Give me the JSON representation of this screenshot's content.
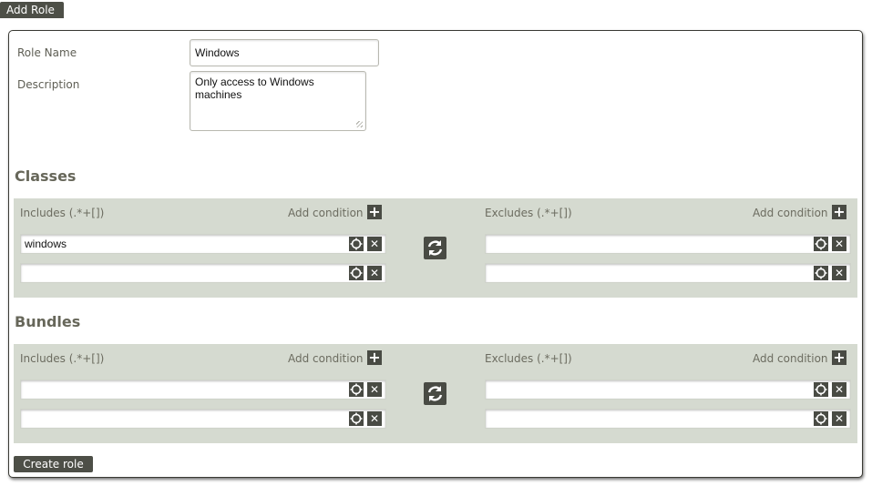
{
  "header": {
    "title": "Add Role"
  },
  "form": {
    "role_name_label": "Role Name",
    "role_name_value": "Windows",
    "description_label": "Description",
    "description_value": "Only access to Windows\nmachines"
  },
  "classes": {
    "title": "Classes",
    "includes": {
      "label": "Includes (.*+[])",
      "add_label": "Add condition",
      "rows": [
        "windows",
        ""
      ]
    },
    "excludes": {
      "label": "Excludes (.*+[])",
      "add_label": "Add condition",
      "rows": [
        "",
        ""
      ]
    }
  },
  "bundles": {
    "title": "Bundles",
    "includes": {
      "label": "Includes (.*+[])",
      "add_label": "Add condition",
      "rows": [
        "",
        ""
      ]
    },
    "excludes": {
      "label": "Excludes (.*+[])",
      "add_label": "Add condition",
      "rows": [
        "",
        ""
      ]
    }
  },
  "footer": {
    "create_label": "Create role"
  },
  "colors": {
    "accent": "#4d4f47",
    "band": "#d5dad0",
    "section_title": "#67675a"
  },
  "icons": {
    "add": "plus-icon",
    "target": "target-icon",
    "remove": "close-icon",
    "swap": "swap-icon",
    "grip": "resize-grip-icon"
  }
}
